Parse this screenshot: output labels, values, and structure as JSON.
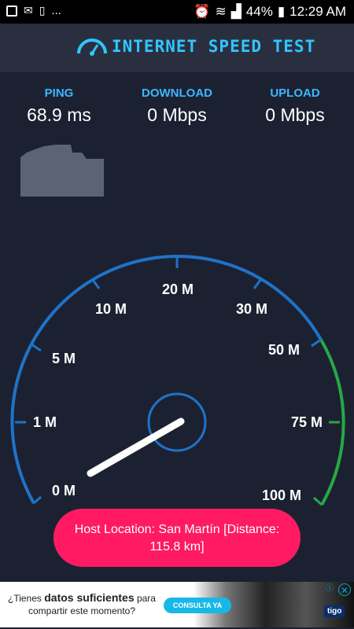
{
  "status": {
    "time": "12:29 AM",
    "battery": "44%",
    "dots": "..."
  },
  "app": {
    "title": "INTERNET SPEED TEST"
  },
  "stats": {
    "ping_label": "PING",
    "ping_value": "68.9 ms",
    "download_label": "DOWNLOAD",
    "download_value": "0 Mbps",
    "upload_label": "UPLOAD",
    "upload_value": "0 Mbps"
  },
  "gauge": {
    "ticks": [
      "0 M",
      "1 M",
      "5 M",
      "10 M",
      "20 M",
      "30 M",
      "50 M",
      "75 M",
      "100 M"
    ],
    "colors": {
      "blue": "#1e73c8",
      "green": "#27a845"
    }
  },
  "host": {
    "text": "Host Location: San Martín [Distance: 115.8 km]"
  },
  "ad": {
    "line1": "¿Tienes ",
    "bold": "datos suficientes",
    "line1b": " para",
    "line2": "compartir este momento?",
    "cta": "CONSULTA YA",
    "brand": "tigo"
  }
}
